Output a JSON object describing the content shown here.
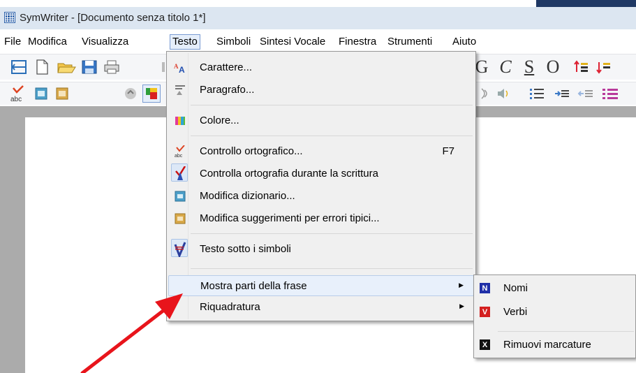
{
  "window": {
    "title": "SymWriter - [Documento senza titolo 1*]"
  },
  "menubar": {
    "items": [
      "File",
      "Modifica",
      "Visualizza",
      "Testo",
      "Simboli",
      "Sintesi Vocale",
      "Finestra",
      "Strumenti",
      "Aiuto"
    ],
    "active": "Testo"
  },
  "format_buttons": {
    "grow": "G",
    "italic": "C",
    "underline": "S",
    "outline": "O"
  },
  "testo_menu": {
    "items": [
      {
        "label": "Carattere...",
        "icon": "font-icon"
      },
      {
        "label": "Paragrafo...",
        "icon": "paragraph-icon"
      },
      {
        "label": "Colore...",
        "icon": "color-palette-icon"
      },
      {
        "label": "Controllo ortografico...",
        "icon": "spellcheck-icon",
        "shortcut": "F7"
      },
      {
        "label": "Controlla ortografia durante la scrittura",
        "icon": "spellcheck-live-icon",
        "checked": true
      },
      {
        "label": "Modifica dizionario...",
        "icon": "dictionary-icon"
      },
      {
        "label": "Modifica suggerimenti per errori tipici...",
        "icon": "suggestions-icon"
      },
      {
        "label": "Testo sotto i simboli",
        "icon": "text-below-symbols-icon",
        "checked": true
      },
      {
        "label": "Mostra parti della frase",
        "submenu": true,
        "highlighted": true
      },
      {
        "label": "Riquadratura",
        "submenu": true
      }
    ]
  },
  "parts_submenu": {
    "items": [
      {
        "badge": "N",
        "label": "Nomi",
        "color": "#1f2fa8"
      },
      {
        "badge": "V",
        "label": "Verbi",
        "color": "#d42020"
      },
      {
        "badge": "X",
        "label": "Rimuovi marcature",
        "color": "#111111"
      }
    ]
  },
  "colors": {
    "annotation_arrow": "#e8141b",
    "titlebar": "#dce6f1",
    "menu_bg": "#f0f0f0",
    "doc_bg": "#ababab"
  }
}
